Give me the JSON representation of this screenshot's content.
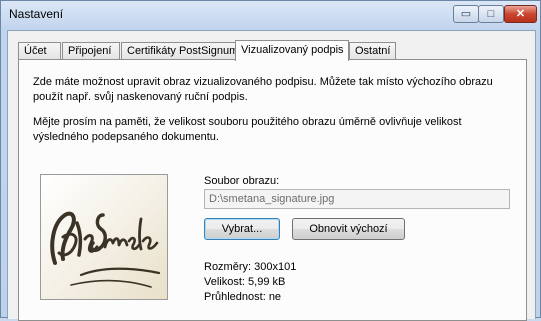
{
  "window": {
    "title": "Nastavení"
  },
  "caption_buttons": {
    "minimize": "▭",
    "maximize": "□",
    "close": "✕"
  },
  "tabs": [
    {
      "label": "Účet"
    },
    {
      "label": "Připojení"
    },
    {
      "label": "Certifikáty PostSignum"
    },
    {
      "label": "Vizualizovaný podpis"
    },
    {
      "label": "Ostatní"
    }
  ],
  "active_tab": "Vizualizovaný podpis",
  "panel": {
    "intro_line1": "Zde máte možnost upravit obraz vizualizovaného podpisu. Můžete tak místo výchozího obrazu",
    "intro_line2": "použít např. svůj naskenovaný ruční podpis.",
    "note_line1": "Mějte prosím na paměti, že velikost souboru použitého obrazu úměrně ovlivňuje velikost",
    "note_line2": "výsledného podepsaného dokumentu.",
    "file_label": "Soubor obrazu:",
    "file_value": "D:\\smetana_signature.jpg",
    "choose_button": "Vybrat...",
    "reset_button": "Obnovit výchozí",
    "dimensions": "Rozměry: 300x101",
    "size": "Velikost: 5,99 kB",
    "transparency": "Průhlednost: ne"
  },
  "colors": {
    "title_bar": "#c2d5ee",
    "panel_bg": "#fcfcfc",
    "close_button": "#c9462f",
    "signature_ink": "#3a3326",
    "signature_paper": "#e9e0c8"
  },
  "icons": {
    "minimize": "minimize-icon",
    "maximize": "maximize-icon",
    "close": "close-icon"
  }
}
